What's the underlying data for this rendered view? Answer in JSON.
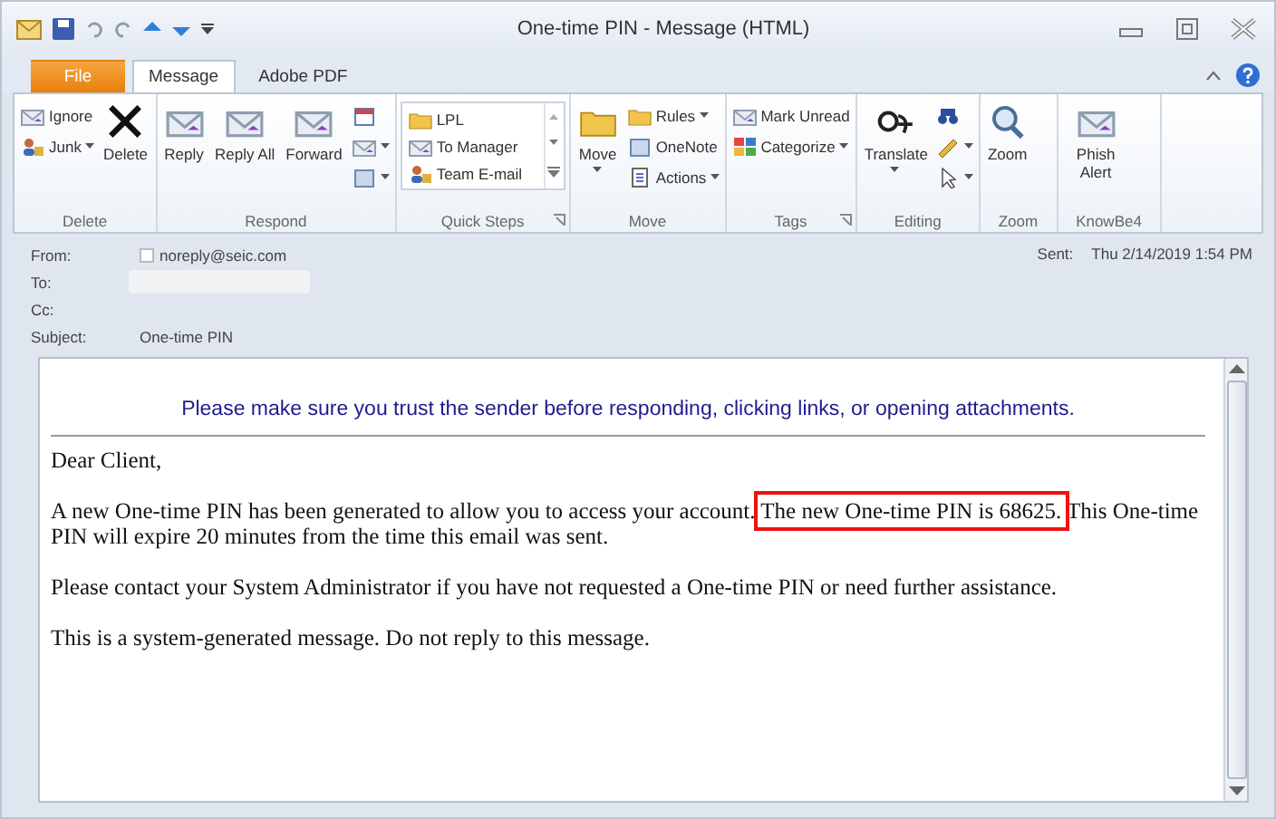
{
  "window": {
    "title": "One-time PIN - Message (HTML)"
  },
  "tabs": [
    {
      "label": "File",
      "kind": "file",
      "selected": false
    },
    {
      "label": "Message",
      "kind": "tab",
      "selected": true
    },
    {
      "label": "Adobe PDF",
      "kind": "tab",
      "selected": false
    }
  ],
  "ribbon": [
    {
      "label": "Delete",
      "launcher": false,
      "items": [
        {
          "kind": "small",
          "label": "Ignore",
          "dropdown": false
        },
        {
          "kind": "small",
          "label": "Junk",
          "dropdown": true
        },
        {
          "kind": "large",
          "label": "Delete",
          "dropdown": false
        }
      ]
    },
    {
      "label": "Respond",
      "launcher": false,
      "items": [
        {
          "kind": "large",
          "label": "Reply",
          "dropdown": false
        },
        {
          "kind": "large",
          "label": "Reply All",
          "dropdown": false
        },
        {
          "kind": "large",
          "label": "Forward",
          "dropdown": false
        },
        {
          "kind": "icon",
          "dropdown": false
        },
        {
          "kind": "icon",
          "dropdown": true
        },
        {
          "kind": "icon",
          "dropdown": true
        }
      ]
    },
    {
      "label": "Quick Steps",
      "launcher": true,
      "items": [
        {
          "kind": "quick",
          "label": "LPL"
        },
        {
          "kind": "quick",
          "label": "To Manager"
        },
        {
          "kind": "quick",
          "label": "Team E-mail"
        }
      ]
    },
    {
      "label": "Move",
      "launcher": false,
      "items": [
        {
          "kind": "large",
          "label": "Move",
          "dropdown": true
        },
        {
          "kind": "small",
          "label": "Rules",
          "dropdown": true
        },
        {
          "kind": "small",
          "label": "OneNote",
          "dropdown": false
        },
        {
          "kind": "small",
          "label": "Actions",
          "dropdown": true
        }
      ]
    },
    {
      "label": "Tags",
      "launcher": true,
      "items": [
        {
          "kind": "small",
          "label": "Mark Unread",
          "dropdown": false
        },
        {
          "kind": "small",
          "label": "Categorize",
          "dropdown": true
        }
      ]
    },
    {
      "label": "Editing",
      "launcher": false,
      "items": [
        {
          "kind": "large",
          "label": "Translate",
          "dropdown": true
        },
        {
          "kind": "icon",
          "dropdown": false
        },
        {
          "kind": "icon",
          "dropdown": true
        },
        {
          "kind": "icon",
          "dropdown": true
        }
      ]
    },
    {
      "label": "Zoom",
      "launcher": false,
      "items": [
        {
          "kind": "large",
          "label": "Zoom",
          "dropdown": false
        }
      ]
    },
    {
      "label": "KnowBe4",
      "launcher": false,
      "items": [
        {
          "kind": "large",
          "label": "Phish Alert",
          "dropdown": false
        }
      ]
    }
  ],
  "header": {
    "from_label": "From:",
    "from": "noreply@seic.com",
    "to_label": "To:",
    "cc_label": "Cc:",
    "subject_label": "Subject:",
    "subject": "One-time PIN",
    "sent_label": "Sent:",
    "sent": "Thu 2/14/2019 1:54 PM"
  },
  "body": {
    "banner": "Please make sure you trust the sender before responding, clicking links, or opening attachments.",
    "greeting": "Dear Client,",
    "paragraph": {
      "before": "A new One-time PIN has been generated to allow you to access your account.",
      "highlighted": "The new One-time PIN is 68625.",
      "after": "This One-time PIN will expire 20 minutes from the time this email was sent."
    },
    "paragraphs": [
      "Please contact your System Administrator if you have not requested a One-time PIN or need further assistance.",
      "This is a system-generated message. Do not reply to this message."
    ]
  }
}
